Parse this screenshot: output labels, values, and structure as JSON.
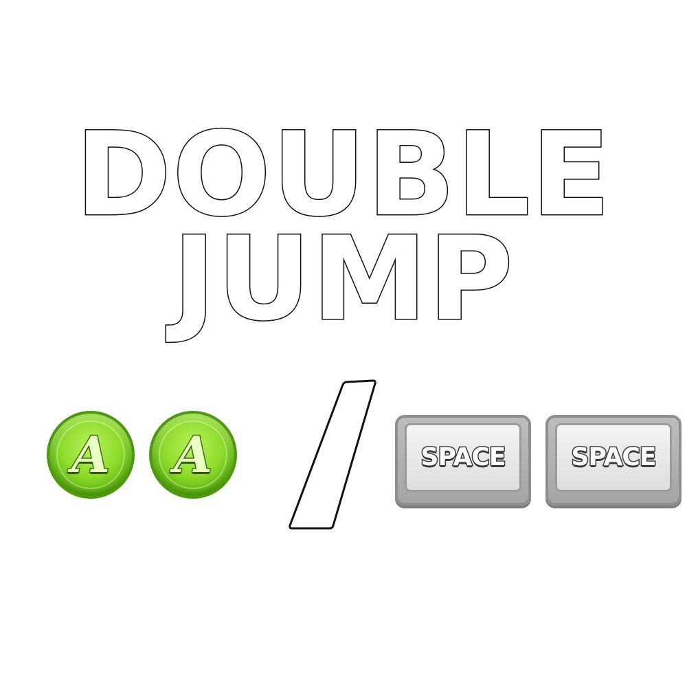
{
  "title": {
    "line1": "DOUBLE",
    "line2": "JUMP"
  },
  "controller": {
    "buttons": [
      {
        "label": "A",
        "color": "#8fdc2c"
      },
      {
        "label": "A",
        "color": "#8fdc2c"
      }
    ]
  },
  "separator": {
    "icon": "slash-separator"
  },
  "keyboard": {
    "keys": [
      {
        "label": "SPACE",
        "color": "#bdbdbd"
      },
      {
        "label": "SPACE",
        "color": "#bdbdbd"
      }
    ]
  }
}
